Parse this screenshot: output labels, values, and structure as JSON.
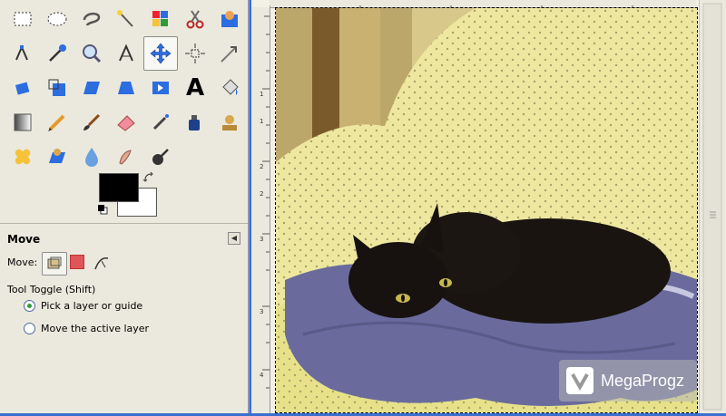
{
  "toolbox": {
    "tools": [
      {
        "icon": "rect-select-icon"
      },
      {
        "icon": "ellipse-select-icon"
      },
      {
        "icon": "free-select-icon"
      },
      {
        "icon": "fuzzy-select-icon"
      },
      {
        "icon": "color-select-icon"
      },
      {
        "icon": "scissors-icon"
      },
      {
        "icon": "foreground-select-icon"
      },
      {
        "icon": "paths-icon"
      },
      {
        "icon": "color-picker-icon"
      },
      {
        "icon": "zoom-icon"
      },
      {
        "icon": "measure-icon"
      },
      {
        "icon": "move-icon",
        "active": true
      },
      {
        "icon": "align-icon"
      },
      {
        "icon": "crop-icon"
      },
      {
        "icon": "rotate-icon"
      },
      {
        "icon": "scale-icon"
      },
      {
        "icon": "shear-icon"
      },
      {
        "icon": "perspective-icon"
      },
      {
        "icon": "flip-icon"
      },
      {
        "icon": "text-icon"
      },
      {
        "icon": "bucket-fill-icon"
      },
      {
        "icon": "blend-icon"
      },
      {
        "icon": "pencil-icon"
      },
      {
        "icon": "paintbrush-icon"
      },
      {
        "icon": "eraser-icon"
      },
      {
        "icon": "airbrush-icon"
      },
      {
        "icon": "ink-icon"
      },
      {
        "icon": "clone-icon"
      },
      {
        "icon": "heal-icon"
      },
      {
        "icon": "perspective-clone-icon"
      },
      {
        "icon": "blur-icon"
      },
      {
        "icon": "smudge-icon"
      },
      {
        "icon": "dodge-burn-icon"
      }
    ],
    "text_tool_glyph": "A",
    "fg_color": "#000000",
    "bg_color": "#ffffff"
  },
  "tool_options": {
    "title": "Move",
    "move_label": "Move:",
    "toggle_label": "Tool Toggle  (Shift)",
    "options": [
      {
        "label": "Pick a layer or guide",
        "checked": true
      },
      {
        "label": "Move the active layer",
        "checked": false
      }
    ]
  },
  "ruler": {
    "vertical_labels": [
      "1",
      "1",
      "2",
      "2",
      "3",
      "3",
      "4"
    ]
  },
  "watermark": {
    "text": "MegaProgz"
  }
}
